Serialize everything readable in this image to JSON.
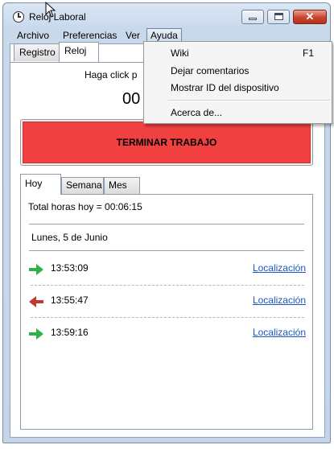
{
  "window": {
    "title": "Reloj Laboral",
    "close_glyph": "✕"
  },
  "menubar": {
    "items": [
      "Archivo",
      "Preferencias",
      "Ver",
      "Ayuda"
    ]
  },
  "tabs": [
    "Registro",
    "Reloj"
  ],
  "reloj": {
    "hint": "Haga click p",
    "timer": "00",
    "stop_button": "TERMINAR TRABAJO"
  },
  "inner_tabs": [
    "Hoy",
    "Semana",
    "Mes"
  ],
  "today": {
    "total": "Total horas hoy = 00:06:15",
    "date": "Lunes, 5 de Junio",
    "entries": [
      {
        "time": "13:53:09",
        "link": "Localización",
        "direction": "in"
      },
      {
        "time": "13:55:47",
        "link": "Localización",
        "direction": "out"
      },
      {
        "time": "13:59:16",
        "link": "Localización",
        "direction": "in"
      }
    ]
  },
  "help_menu": {
    "items": [
      {
        "label": "Wiki",
        "shortcut": "F1"
      },
      {
        "label": "Dejar comentarios",
        "shortcut": ""
      },
      {
        "label": "Mostrar ID del dispositivo",
        "shortcut": ""
      },
      {
        "label": "Acerca de...",
        "shortcut": ""
      }
    ]
  },
  "colors": {
    "in_arrow": "#2bb34a",
    "out_arrow": "#c0392b",
    "stop_button": "#f04040",
    "link": "#1a56c4"
  }
}
